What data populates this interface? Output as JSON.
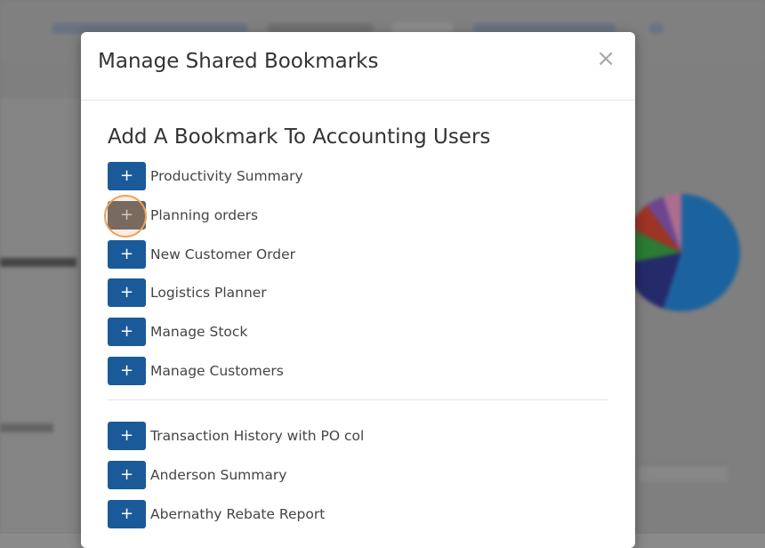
{
  "modal": {
    "title": "Manage Shared Bookmarks",
    "close_icon": "×",
    "section_title": "Add A Bookmark To Accounting Users",
    "add_icon": "+",
    "group_one": [
      {
        "label": "Productivity Summary"
      },
      {
        "label": "Planning orders",
        "state": "hover"
      },
      {
        "label": "New Customer Order"
      },
      {
        "label": "Logistics Planner"
      },
      {
        "label": "Manage Stock"
      },
      {
        "label": "Manage Customers"
      }
    ],
    "group_two": [
      {
        "label": "Transaction History with PO col"
      },
      {
        "label": "Anderson Summary"
      },
      {
        "label": "Abernathy Rebate Report"
      }
    ]
  },
  "colors": {
    "button": "#1b5a99",
    "button_hover": "#5f5f5f",
    "click_ring": "#f0a15c"
  }
}
